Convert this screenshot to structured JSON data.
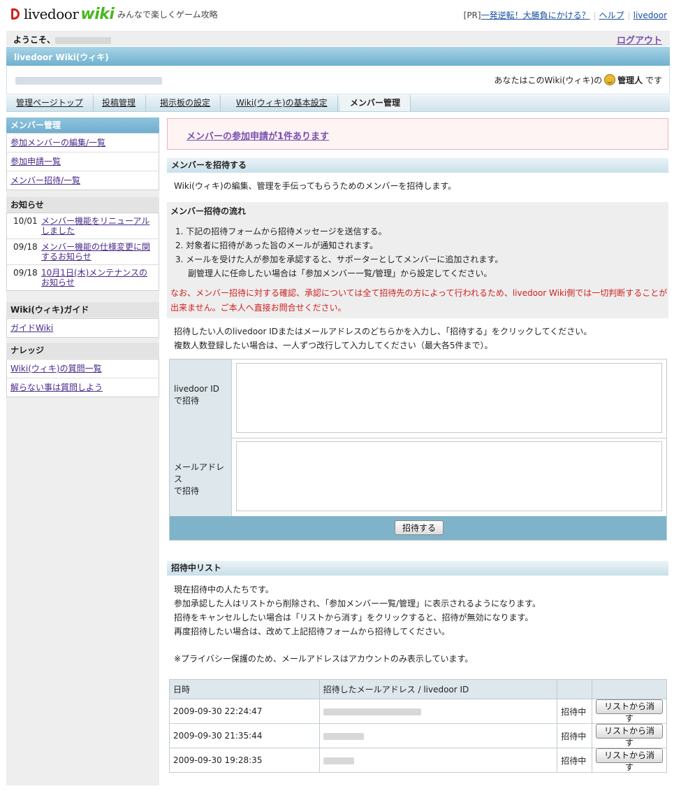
{
  "header": {
    "logo_text": "livedoor",
    "logo_wiki": "wiki",
    "tagline": "みんなで楽しくゲーム攻略",
    "pr_tag": "[PR]",
    "pr_link": "一発逆転！大勝負にかける？",
    "help": "ヘルプ",
    "livedoor": "livedoor"
  },
  "welcome": {
    "greeting": "ようこそ、",
    "logout": "ログアウト"
  },
  "title_bar": "livedoor Wiki(ウィキ)",
  "role": {
    "prefix": "あなたはこのWiki(ウィキ)の",
    "role": "管理人",
    "suffix": "です"
  },
  "nav": {
    "items": [
      "管理ページトップ",
      "投稿管理",
      "掲示板の設定",
      "Wiki(ウィキ)の基本設定",
      "メンバー管理"
    ]
  },
  "sidebar": {
    "member": {
      "heading": "メンバー管理",
      "items": [
        "参加メンバーの編集/一覧",
        "参加申請一覧",
        "メンバー招待/一覧"
      ]
    },
    "news": {
      "heading": "お知らせ",
      "items": [
        {
          "date": "10/01",
          "text": "メンバー機能をリニューアルしました"
        },
        {
          "date": "09/18",
          "text": "メンバー機能の仕様変更に関するお知らせ"
        },
        {
          "date": "09/18",
          "text": "10月1日(木)メンテナンスのお知らせ"
        }
      ]
    },
    "guide": {
      "heading": "Wiki(ウィキ)ガイド",
      "items": [
        "ガイドWiki"
      ]
    },
    "knowledge": {
      "heading": "ナレッジ",
      "items": [
        "Wiki(ウィキ)の質問一覧",
        "解らない事は質問しよう"
      ]
    }
  },
  "notice": "メンバーの参加申請が1件あります",
  "invite": {
    "heading": "メンバーを招待する",
    "intro": "Wiki(ウィキ)の編集、管理を手伝ってもらうためのメンバーを招待します。",
    "flow_heading": "メンバー招待の流れ",
    "steps": [
      "1.  下記の招待フォームから招待メッセージを送信する。",
      "2.  対象者に招待があった旨のメールが通知されます。",
      "3.  メールを受けた人が参加を承認すると、サポーターとしてメンバーに追加されます。"
    ],
    "step_note": "副管理人に任命したい場合は「参加メンバー一覧/管理」から設定してください。",
    "warning": "なお、メンバー招待に対する確認、承認については全て招待先の方によって行われるため、livedoor Wiki側では一切判断することが出来ません。ご本人へ直接お問合せください。",
    "instructions": [
      "招待したい人のlivedoor IDまたはメールアドレスのどちらかを入力し、「招待する」をクリックしてください。",
      "複数人数登録したい場合は、一人ずつ改行して入力してください（最大各5件まで）。"
    ],
    "label_id_1": "livedoor ID",
    "label_id_2": "で招待",
    "label_mail_1": "メールアドレス",
    "label_mail_2": "で招待",
    "submit": "招待する"
  },
  "pending": {
    "heading": "招待中リスト",
    "lines": [
      "現在招待中の人たちです。",
      "参加承認した人はリストから削除され、「参加メンバー一覧/管理」に表示されるようになります。",
      "招待をキャンセルしたい場合は「リストから消す」をクリックすると、招待が無効になります。",
      "再度招待したい場合は、改めて上記招待フォームから招待してください。"
    ],
    "privacy": "※プライバシー保護のため、メールアドレスはアカウントのみ表示しています。",
    "columns": [
      "日時",
      "招待したメールアドレス / livedoor ID",
      "",
      ""
    ],
    "rows": [
      {
        "datetime": "2009-09-30 22:24:47",
        "status": "招待中",
        "action": "リストから消す"
      },
      {
        "datetime": "2009-09-30 21:35:44",
        "status": "招待中",
        "action": "リストから消す"
      },
      {
        "datetime": "2009-09-30 19:28:35",
        "status": "招待中",
        "action": "リストから消す"
      }
    ]
  }
}
